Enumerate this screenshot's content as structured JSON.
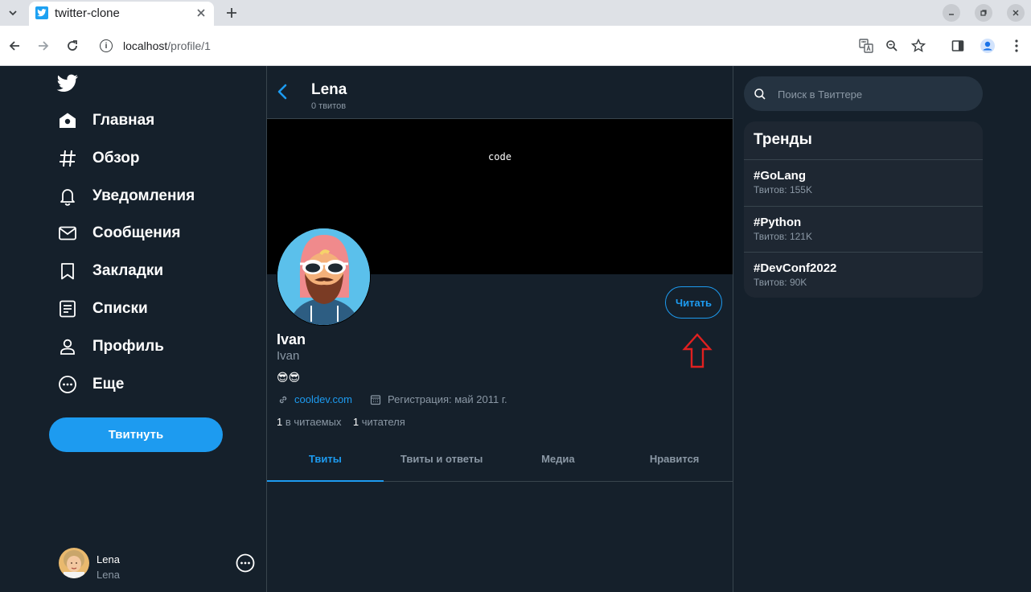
{
  "browser": {
    "tab_title": "twitter-clone",
    "url_host": "localhost",
    "url_path": "/profile/1"
  },
  "sidebar": {
    "nav": [
      {
        "label": "Главная",
        "icon": "home-icon"
      },
      {
        "label": "Обзор",
        "icon": "hashtag-icon"
      },
      {
        "label": "Уведомления",
        "icon": "bell-icon"
      },
      {
        "label": "Сообщения",
        "icon": "mail-icon"
      },
      {
        "label": "Закладки",
        "icon": "bookmark-icon"
      },
      {
        "label": "Списки",
        "icon": "list-icon"
      },
      {
        "label": "Профиль",
        "icon": "person-icon"
      },
      {
        "label": "Еще",
        "icon": "more-circle-icon"
      }
    ],
    "tweet_button": "Твитнуть",
    "current_user": {
      "name": "Lena",
      "handle": "Lena"
    }
  },
  "profile_header": {
    "name": "Lena",
    "tweet_count": "0 твитов"
  },
  "profile": {
    "banner_text": "code",
    "name": "Ivan",
    "handle": "Ivan",
    "bio": "😎😎",
    "website": "cooldev.com",
    "registration": "Регистрация: май 2011 г.",
    "following_count": "1",
    "following_label": "в читаемых",
    "followers_count": "1",
    "followers_label": "читателя",
    "follow_button": "Читать"
  },
  "profile_tabs": [
    {
      "label": "Твиты",
      "active": true
    },
    {
      "label": "Твиты и ответы",
      "active": false
    },
    {
      "label": "Медиа",
      "active": false
    },
    {
      "label": "Нравится",
      "active": false
    }
  ],
  "search": {
    "placeholder": "Поиск в Твиттере"
  },
  "trends": {
    "title": "Тренды",
    "items": [
      {
        "tag": "#GoLang",
        "count": "Твитов: 155K"
      },
      {
        "tag": "#Python",
        "count": "Твитов: 121K"
      },
      {
        "tag": "#DevConf2022",
        "count": "Твитов: 90K"
      }
    ]
  },
  "colors": {
    "background": "#15202b",
    "accent": "#1d9bf0",
    "muted": "#8b98a5",
    "annotation_arrow": "#e02020"
  }
}
